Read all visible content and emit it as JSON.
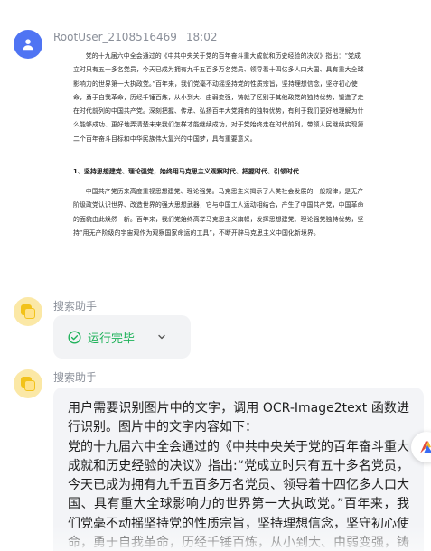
{
  "user_message": {
    "username": "RootUser_2108516469",
    "time": "18:02",
    "document": {
      "para1": "党的十九届六中全会通过的《中共中央关于党的百年奋斗重大成就和历史经验的决议》指出：“党成立时只有五十多名党员，今天已成为拥有九千五百多万名党员、领导着十四亿多人口大国、具有重大全球影响力的世界第一大执政党。”百年来，我们党毫不动摇坚持党的性质宗旨，坚持理想信念，坚守初心使命，勇于自我革命，历经千锤百炼，从小到大、由弱变强，铸就了区别于其他政党的独特优势，锻造了走在时代前列的中国共产党。深刻把握、传承、弘扬百年大党拥有的独特优势，有利于我们更好地理解为什么能够成功、更好地弄清楚未来我们怎样才能继续成功，对于党始终走在时代前列，带领人民继续实现第二个百年奋斗目标和中华民族伟大复兴的中国梦，具有重要意义。",
      "heading1": "1、坚持思想建党、理论强党，始终用马克思主义观察时代、把握时代、引领时代",
      "para2": "中国共产党历来高度重视思想建党、理论强党。马克思主义揭示了人类社会发展的一般规律，是无产阶级政党认识世界、改造世界的强大思想武器，它与中国工人运动相结合，产生了中国共产党，中国革命的面貌由此焕然一新。百年来，我们党始终高举马克思主义旗帜，发挥思想建党、理论强党独特优势，坚持“用无产阶级的宇宙观作为观察国家命运的工具”，不断开辟马克思主义中国化新境界。"
    }
  },
  "bot_name": "搜索助手",
  "tool_status": {
    "label": "运行完毕"
  },
  "answer": {
    "text": "用户需要识别图片中的文字，调用 OCR-Image2text 函数进行识别。图片中的文字内容如下：",
    "quote": "党的十九届六中全会通过的《中共中央关于党的百年奋斗重大成就和历史经验的决议》指出:“党成立时只有五十多名党员，今天已成为拥有九千五百多万名党员、领导着十四亿多人口大国、具有重大全球影响力的世界第一大执政党。”百年来，我们党毫不动摇坚持党的性质宗旨，坚持理想信念，坚守初心使命，勇于自我革命，历经千锤百炼，从小到大、由弱变强，铸"
  },
  "colors": {
    "user_avatar": "#4f74f3",
    "bot_avatar_bg": "#fbe8a6",
    "bot_avatar_accent": "#f2c21a",
    "status_green": "#1fb25a",
    "bubble_bg": "#f3f4f7"
  },
  "icons": {
    "user_avatar": "person-icon",
    "status": "check-circle-icon",
    "expand": "chevron-down-icon",
    "float_badge": "app-logo-icon"
  }
}
